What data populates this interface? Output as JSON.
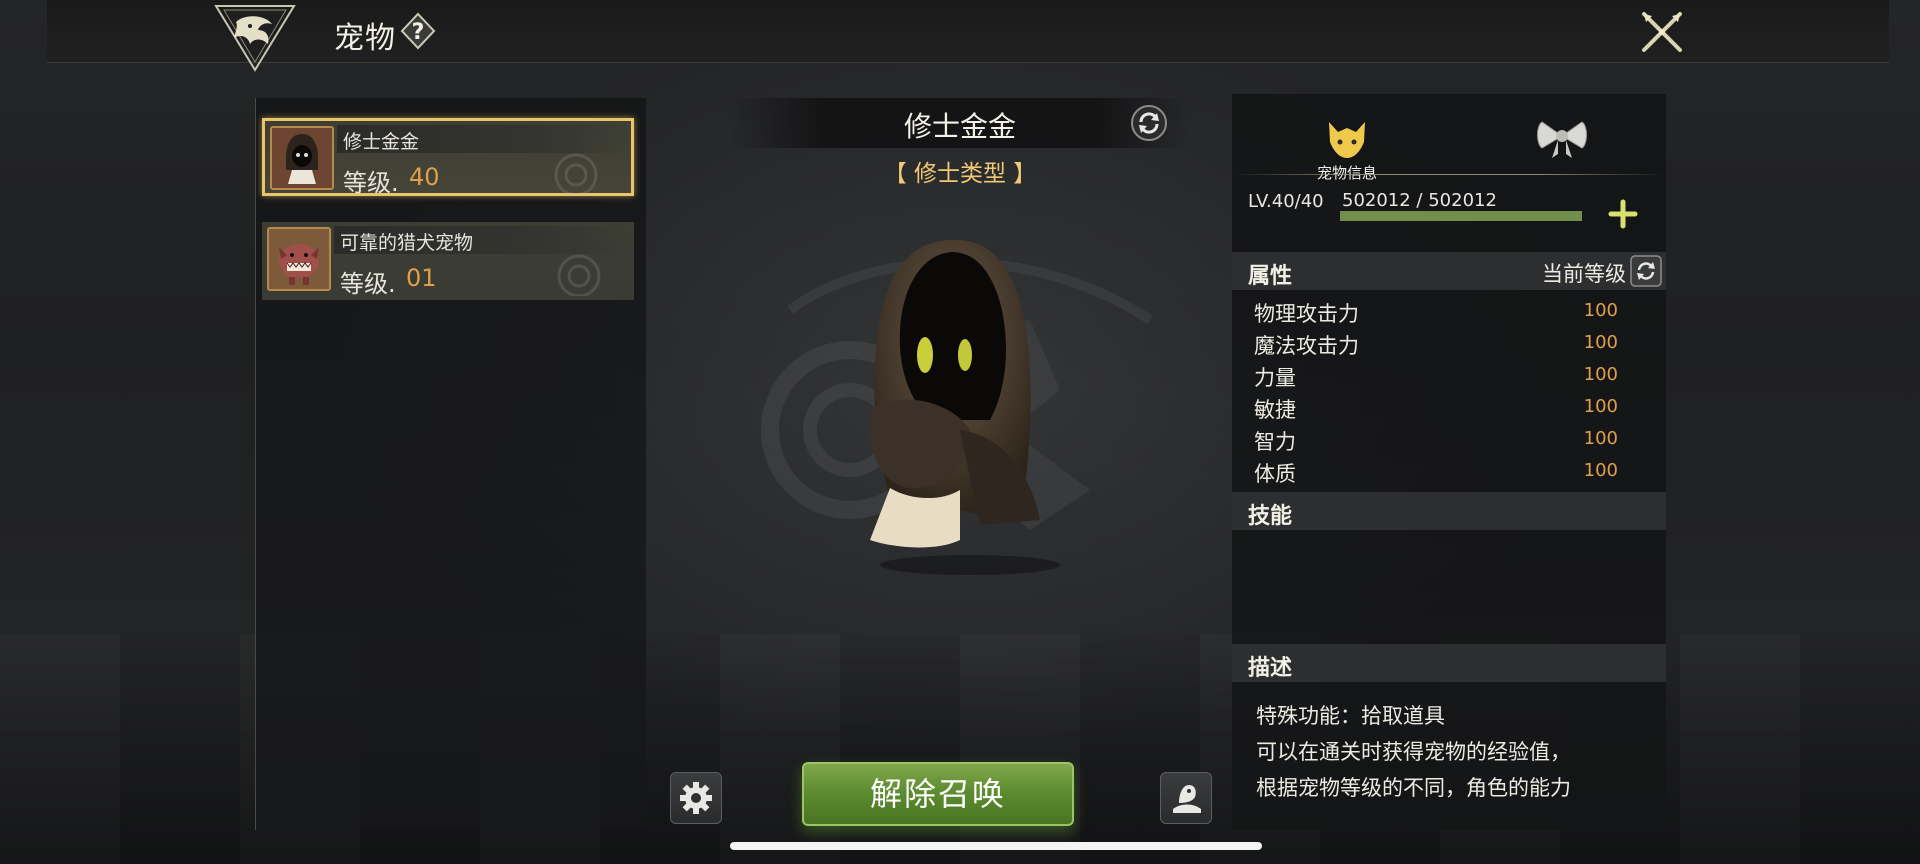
{
  "header": {
    "title": "宠物",
    "help_icon": "question-diamond-icon",
    "close_icon": "crossed-swords-close-icon"
  },
  "pet_list": [
    {
      "name": "修士金金",
      "level_label": "等级.",
      "level": "40",
      "selected": true
    },
    {
      "name": "可靠的猎犬宠物",
      "level_label": "等级.",
      "level": "01",
      "selected": false
    }
  ],
  "center": {
    "pet_name": "修士金金",
    "pet_type": "【 修士类型 】",
    "dismiss_label": "解除召唤"
  },
  "info": {
    "tab_info_label": "宠物信息",
    "level_text": "LV.40/40",
    "exp_text": "502012 / 502012",
    "exp_fraction": 1.0,
    "attributes_header": "属性",
    "current_level_label": "当前等级",
    "stats": [
      {
        "name": "物理攻击力",
        "value": "100"
      },
      {
        "name": "魔法攻击力",
        "value": "100"
      },
      {
        "name": "力量",
        "value": "100"
      },
      {
        "name": "敏捷",
        "value": "100"
      },
      {
        "name": "智力",
        "value": "100"
      },
      {
        "name": "体质",
        "value": "100"
      }
    ],
    "skills_header": "技能",
    "desc_header": "描述",
    "desc_lines": [
      "特殊功能：拾取道具",
      "可以在通关时获得宠物的经验值，",
      "根据宠物等级的不同，角色的能力"
    ]
  },
  "colors": {
    "accent_gold": "#e9c56a",
    "level_orange": "#e0a04a",
    "button_green": "#5b8a2e",
    "exp_green": "#6f8f4a"
  }
}
